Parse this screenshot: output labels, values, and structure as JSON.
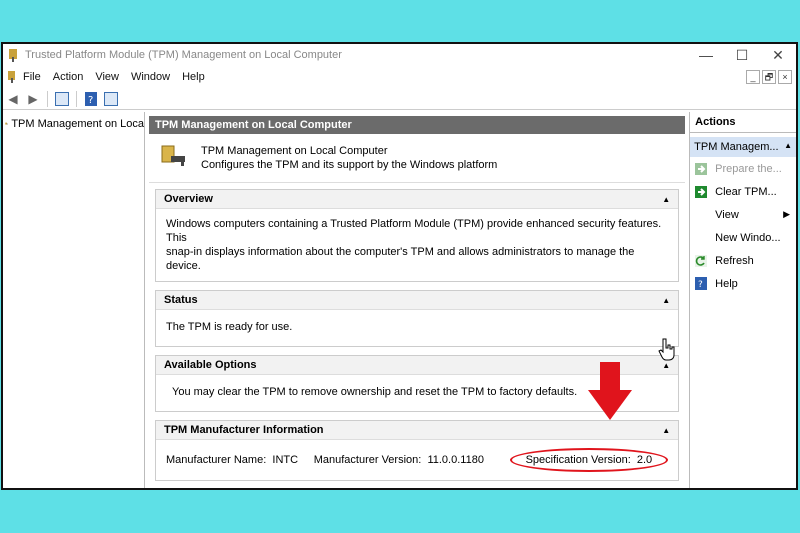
{
  "window": {
    "title": "Trusted Platform Module (TPM) Management on Local Computer"
  },
  "window_controls": {
    "minimize": "—",
    "maximize": "☐",
    "close": "✕"
  },
  "menu": [
    "File",
    "Action",
    "View",
    "Window",
    "Help"
  ],
  "mdi_controls": {
    "minimize": "_",
    "restore": "🗗",
    "close": "×"
  },
  "tree": {
    "item": "TPM Management on Loca"
  },
  "center": {
    "header": "TPM Management on Local Computer",
    "intro_title": "TPM Management on Local Computer",
    "intro_desc": "Configures the TPM and its support by the Windows platform"
  },
  "overview": {
    "title": "Overview",
    "line1": "Windows computers containing a Trusted Platform Module (TPM) provide enhanced security features. This",
    "line2": "snap-in displays information about the computer's TPM and allows administrators to manage the device."
  },
  "status": {
    "title": "Status",
    "text": "The TPM is ready for use."
  },
  "options": {
    "title": "Available Options",
    "text": "You may clear the TPM to remove ownership and reset the TPM to factory defaults."
  },
  "manufacturer": {
    "title": "TPM Manufacturer Information",
    "name_label": "Manufacturer Name:",
    "name_value": "INTC",
    "version_label": "Manufacturer Version:",
    "version_value": "11.0.0.1180",
    "spec_label": "Specification Version:",
    "spec_value": "2.0"
  },
  "actions": {
    "title": "Actions",
    "section": "TPM Managem...",
    "items": [
      {
        "label": "Prepare the...",
        "icon": "green-arrow-icon",
        "disabled": true
      },
      {
        "label": "Clear TPM...",
        "icon": "green-arrow-icon",
        "disabled": false
      },
      {
        "label": "View",
        "icon": "",
        "disabled": false
      },
      {
        "label": "New Windo...",
        "icon": "",
        "disabled": false
      },
      {
        "label": "Refresh",
        "icon": "refresh-icon",
        "disabled": false
      },
      {
        "label": "Help",
        "icon": "help-icon",
        "disabled": false
      }
    ]
  },
  "colors": {
    "accent_red": "#e0141c",
    "header_gray": "#6b6b6b",
    "action_highlight": "#d5e3f5",
    "background": "#5ee0e6"
  }
}
